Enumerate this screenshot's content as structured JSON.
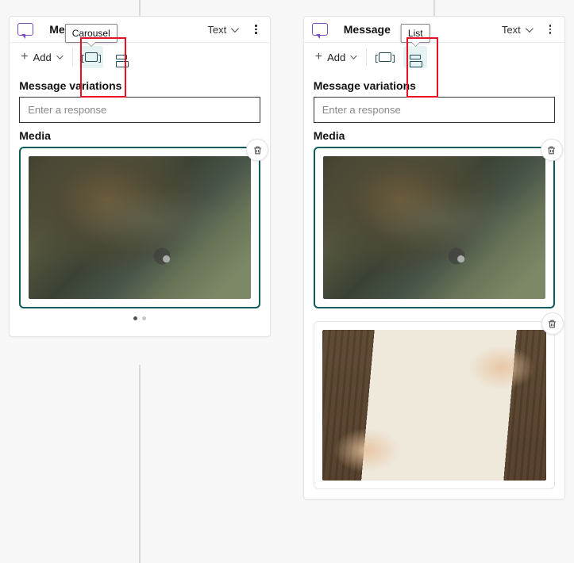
{
  "left": {
    "title": "Message",
    "text_dropdown": "Text",
    "add_label": "Add",
    "tooltip": "Carousel",
    "section_variations": "Message variations",
    "response_placeholder": "Enter a response",
    "section_media": "Media"
  },
  "right": {
    "title": "Message",
    "text_dropdown": "Text",
    "add_label": "Add",
    "tooltip": "List",
    "section_variations": "Message variations",
    "response_placeholder": "Enter a response",
    "section_media": "Media"
  }
}
